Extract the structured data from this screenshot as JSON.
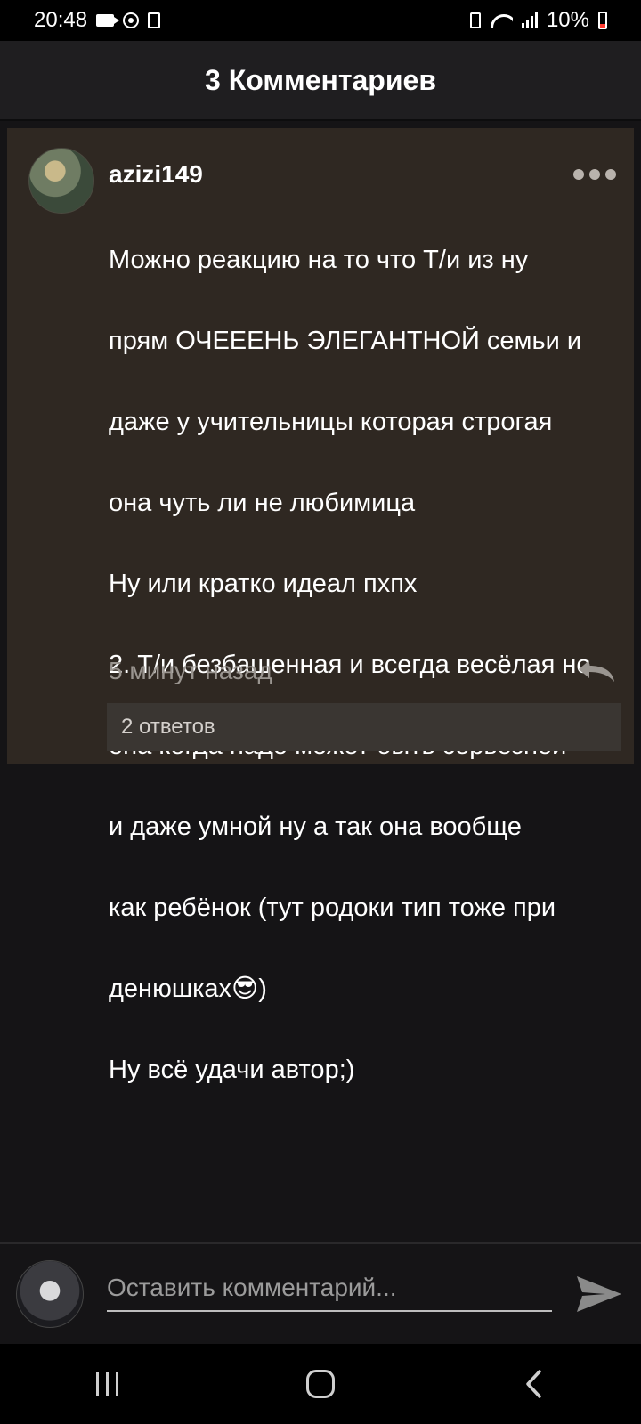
{
  "status_bar": {
    "time": "20:48",
    "battery": "10%"
  },
  "header": {
    "title": "3 Комментариев"
  },
  "comment": {
    "username": "azizi149",
    "text_lines": [
      "Можно реакцию на то что Т/и из ну",
      "прям ОЧЕЕЕНЬ ЭЛЕГАНТНОЙ семьи и",
      "даже у учительницы которая строгая",
      "она чуть ли не любимица",
      "Ну или кратко идеал пхпх",
      "2. Т/и безбашенная и всегда весёлая но",
      "она когда надо может быть серьёзной",
      "и даже умной ну а так она вообще",
      "как ребёнок (тут родоки тип тоже при",
      "денюшках😎)",
      "Ну всё удачи автор;)"
    ],
    "timestamp": "5 минут назад",
    "replies": "2 ответов"
  },
  "input": {
    "placeholder": "Оставить комментарий..."
  },
  "icons": {
    "more": "more-dots-icon",
    "reply": "reply-icon",
    "send": "send-icon",
    "recents": "recents-icon",
    "home": "home-icon",
    "back": "back-icon"
  },
  "colors": {
    "card_background": "#2f2822",
    "page_background": "#151416",
    "header_background": "#1f1e20"
  }
}
